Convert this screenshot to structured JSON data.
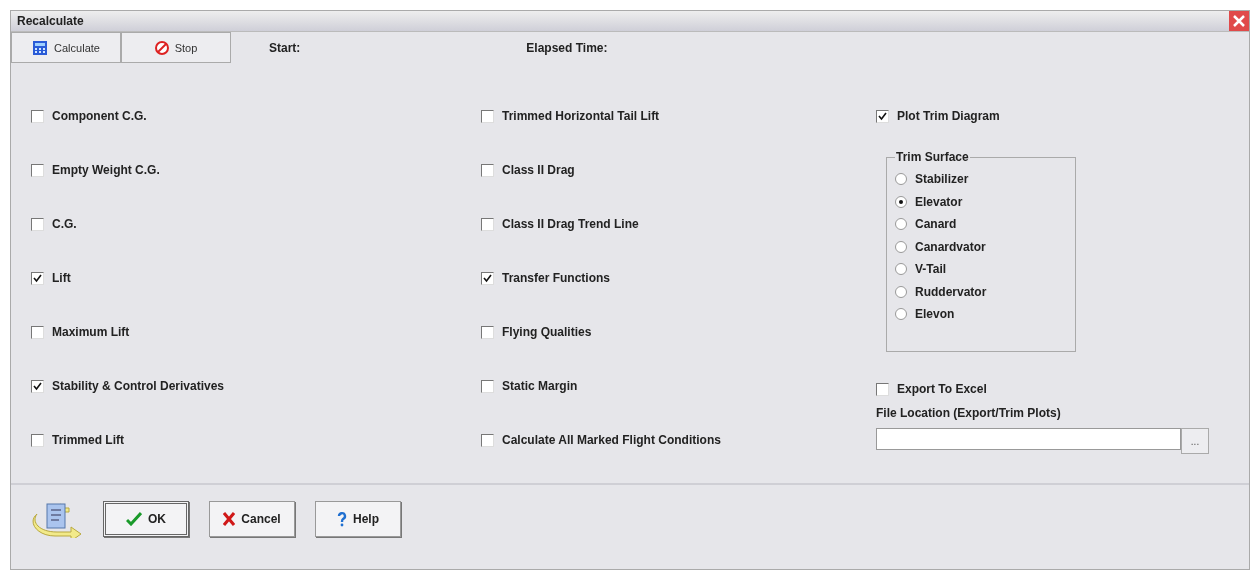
{
  "window": {
    "title": "Recalculate"
  },
  "toolbar": {
    "buttons": [
      {
        "label": "Calculate",
        "kind": "calculate"
      },
      {
        "label": "Stop",
        "kind": "stop"
      }
    ],
    "start_label": "Start:",
    "elapsed_label": "Elapsed Time:"
  },
  "columns": [
    [
      {
        "label": "Component C.G.",
        "checked": false
      },
      {
        "label": "Empty Weight C.G.",
        "checked": false
      },
      {
        "label": "C.G.",
        "checked": false
      },
      {
        "label": "Lift",
        "checked": true
      },
      {
        "label": "Maximum Lift",
        "checked": false
      },
      {
        "label": "Stability & Control Derivatives",
        "checked": true
      },
      {
        "label": "Trimmed Lift",
        "checked": false
      }
    ],
    [
      {
        "label": "Trimmed Horizontal Tail Lift",
        "checked": false
      },
      {
        "label": "Class II Drag",
        "checked": false
      },
      {
        "label": "Class II Drag Trend Line",
        "checked": false
      },
      {
        "label": "Transfer Functions",
        "checked": true
      },
      {
        "label": "Flying Qualities",
        "checked": false
      },
      {
        "label": "Static Margin",
        "checked": false
      },
      {
        "label": "Calculate All Marked Flight Conditions",
        "checked": false
      }
    ]
  ],
  "plot_trim": {
    "label": "Plot Trim Diagram",
    "checked": true
  },
  "trim_surface": {
    "title": "Trim Surface",
    "options": [
      {
        "label": "Stabilizer",
        "selected": false
      },
      {
        "label": "Elevator",
        "selected": true
      },
      {
        "label": "Canard",
        "selected": false
      },
      {
        "label": "Canardvator",
        "selected": false
      },
      {
        "label": "V-Tail",
        "selected": false
      },
      {
        "label": "Ruddervator",
        "selected": false
      },
      {
        "label": "Elevon",
        "selected": false
      }
    ]
  },
  "export": {
    "label": "Export To Excel",
    "checked": false
  },
  "file_location": {
    "label": "File Location (Export/Trim Plots)",
    "browse": "..."
  },
  "footer": {
    "buttons": [
      {
        "label": "OK",
        "kind": "ok",
        "default": true
      },
      {
        "label": "Cancel",
        "kind": "cancel",
        "default": false
      },
      {
        "label": "Help",
        "kind": "help",
        "default": false
      }
    ]
  }
}
